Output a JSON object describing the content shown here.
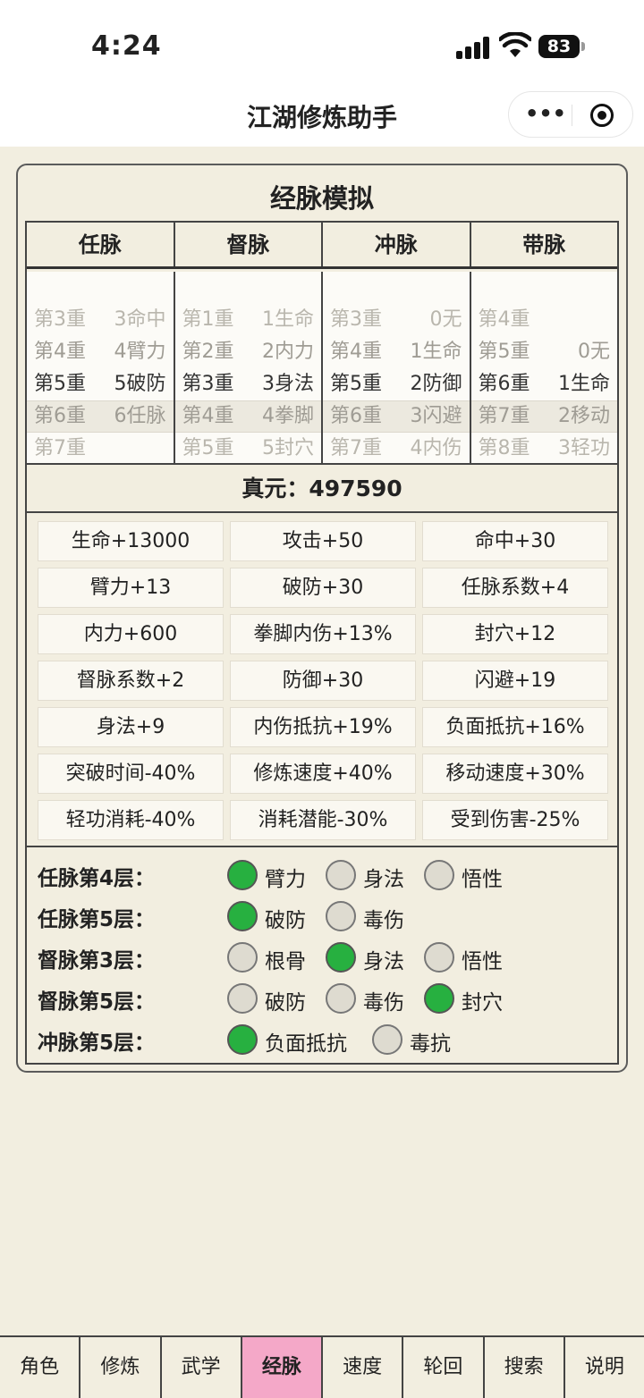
{
  "status": {
    "time": "4:24",
    "battery": "83"
  },
  "nav": {
    "title": "江湖修炼助手"
  },
  "card": {
    "title": "经脉模拟"
  },
  "meridians": [
    {
      "name": "任脉",
      "rows": [
        [
          "第3重",
          "3命中"
        ],
        [
          "第4重",
          "4臂力"
        ],
        [
          "第5重",
          "5破防"
        ],
        [
          "第6重",
          "6任脉"
        ],
        [
          "第7重",
          ""
        ]
      ]
    },
    {
      "name": "督脉",
      "rows": [
        [
          "第1重",
          "1生命"
        ],
        [
          "第2重",
          "2内力"
        ],
        [
          "第3重",
          "3身法"
        ],
        [
          "第4重",
          "4拳脚"
        ],
        [
          "第5重",
          "5封穴"
        ]
      ]
    },
    {
      "name": "冲脉",
      "rows": [
        [
          "第3重",
          "0无"
        ],
        [
          "第4重",
          "1生命"
        ],
        [
          "第5重",
          "2防御"
        ],
        [
          "第6重",
          "3闪避"
        ],
        [
          "第7重",
          "4内伤"
        ]
      ]
    },
    {
      "name": "带脉",
      "rows": [
        [
          "第4重",
          ""
        ],
        [
          "第5重",
          "0无"
        ],
        [
          "第6重",
          "1生命"
        ],
        [
          "第7重",
          "2移动"
        ],
        [
          "第8重",
          "3轻功"
        ]
      ]
    }
  ],
  "zhenyuan": "真元：497590",
  "stats": [
    "生命+13000",
    "攻击+50",
    "命中+30",
    "臂力+13",
    "破防+30",
    "任脉系数+4",
    "内力+600",
    "拳脚内伤+13%",
    "封穴+12",
    "督脉系数+2",
    "防御+30",
    "闪避+19",
    "身法+9",
    "内伤抵抗+19%",
    "负面抵抗+16%",
    "突破时间-40%",
    "修炼速度+40%",
    "移动速度+30%",
    "轻功消耗-40%",
    "消耗潜能-30%",
    "受到伤害-25%"
  ],
  "options": [
    {
      "label": "任脉第4层：",
      "choices": [
        {
          "text": "臂力",
          "on": true
        },
        {
          "text": "身法",
          "on": false
        },
        {
          "text": "悟性",
          "on": false
        }
      ]
    },
    {
      "label": "任脉第5层：",
      "choices": [
        {
          "text": "破防",
          "on": true
        },
        {
          "text": "毒伤",
          "on": false
        }
      ]
    },
    {
      "label": "督脉第3层：",
      "choices": [
        {
          "text": "根骨",
          "on": false
        },
        {
          "text": "身法",
          "on": true
        },
        {
          "text": "悟性",
          "on": false
        }
      ]
    },
    {
      "label": "督脉第5层：",
      "choices": [
        {
          "text": "破防",
          "on": false
        },
        {
          "text": "毒伤",
          "on": false
        },
        {
          "text": "封穴",
          "on": true
        }
      ]
    },
    {
      "label": "冲脉第5层：",
      "choices": [
        {
          "text": "负面抵抗",
          "on": true
        },
        {
          "text": "毒抗",
          "on": false
        }
      ]
    }
  ],
  "tabs": [
    "角色",
    "修炼",
    "武学",
    "经脉",
    "速度",
    "轮回",
    "搜索",
    "说明"
  ],
  "active_tab": "经脉",
  "colors": {
    "accent_tab": "#f4a8c8",
    "radio_on": "#27b040",
    "background": "#f2eee0"
  }
}
